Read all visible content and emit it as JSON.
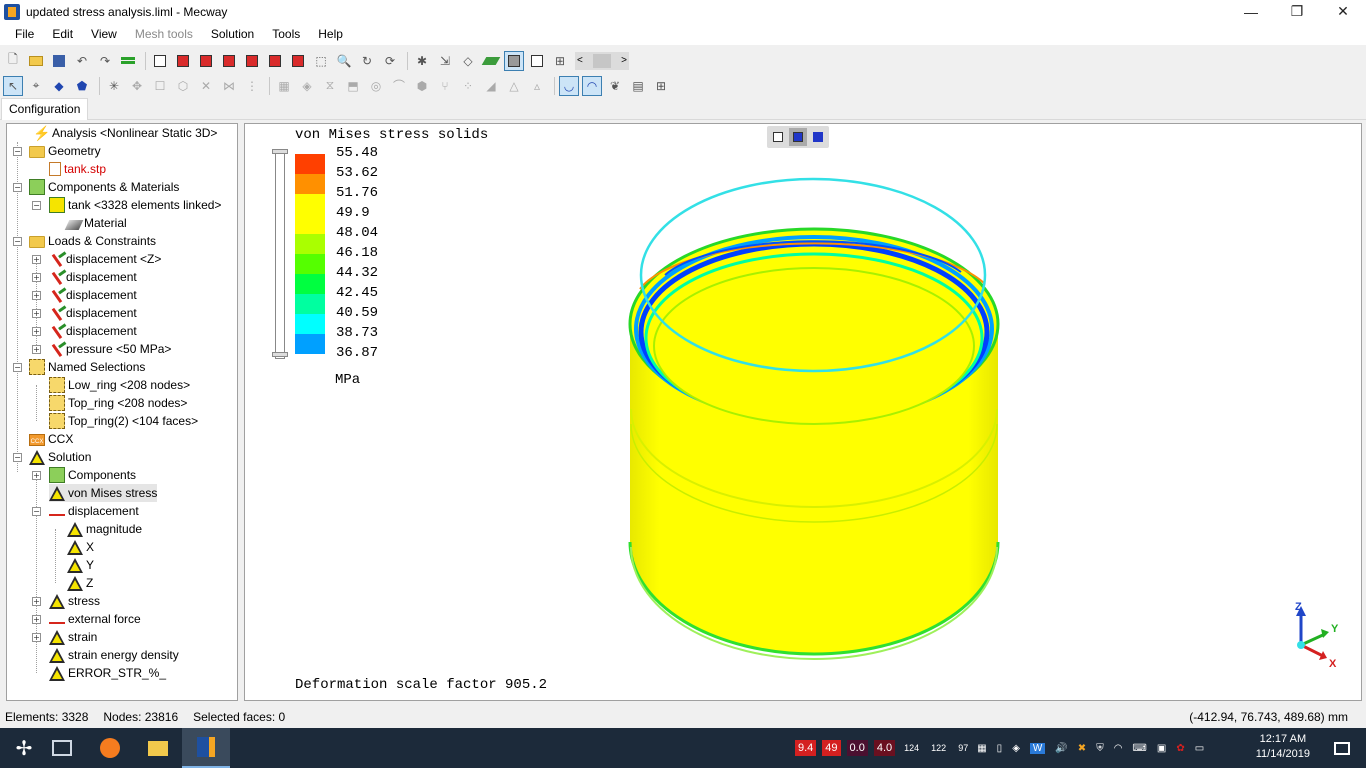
{
  "window": {
    "title": "updated stress analysis.liml - Mecway",
    "minimize": "—",
    "maximize": "❐",
    "close": "✕"
  },
  "menu": {
    "items": [
      "File",
      "Edit",
      "View",
      "Mesh tools",
      "Solution",
      "Tools",
      "Help"
    ]
  },
  "toolbar": {
    "scroll_left": "<",
    "scroll_right": ">"
  },
  "tabs": {
    "configuration": "Configuration"
  },
  "tree": {
    "analysis": "Analysis <Nonlinear Static 3D>",
    "geometry": "Geometry",
    "geometry_file": "tank.stp",
    "components_materials": "Components & Materials",
    "tank": "tank <3328 elements linked>",
    "material": "Material",
    "loads_constraints": "Loads & Constraints",
    "loads": [
      "displacement <Z>",
      "displacement",
      "displacement",
      "displacement",
      "displacement",
      "pressure <50 MPa>"
    ],
    "named_selections": "Named Selections",
    "selections": [
      "Low_ring <208 nodes>",
      "Top_ring <208 nodes>",
      "Top_ring(2) <104 faces>"
    ],
    "ccx": "CCX",
    "solution": "Solution",
    "components": "Components",
    "von_mises": "von Mises stress",
    "displacement": "displacement",
    "magnitude": "magnitude",
    "x": "X",
    "y": "Y",
    "z": "Z",
    "stress": "stress",
    "external_force": "external force",
    "strain": "strain",
    "strain_energy_density": "strain energy density",
    "error_str": "ERROR_STR_%_"
  },
  "viewport": {
    "title": "von Mises stress solids",
    "unit": "MPa",
    "deformation_scale": "Deformation scale factor 905.2",
    "legend": {
      "values": [
        "55.48",
        "53.62",
        "51.76",
        "49.9",
        "48.04",
        "46.18",
        "44.32",
        "42.45",
        "40.59",
        "38.73",
        "36.87"
      ],
      "colors": [
        "#ff4000",
        "#ff9000",
        "#ffff00",
        "#ffff00",
        "#aaff00",
        "#55ff00",
        "#00ff40",
        "#00ffa0",
        "#00ffff",
        "#00a0ff",
        "#0040ff"
      ]
    },
    "axis": {
      "x": "X",
      "y": "Y",
      "z": "Z"
    }
  },
  "status": {
    "elements": "Elements: 3328",
    "nodes": "Nodes: 23816",
    "selected_faces": "Selected faces: 0",
    "coordinates": "(-412.94, 76.743, 489.68) mm"
  },
  "taskbar": {
    "tray_badges": [
      "9.4",
      "49",
      "0.0",
      "4.0",
      "124",
      "122",
      "97"
    ],
    "time": "12:17 AM",
    "date": "11/14/2019"
  }
}
